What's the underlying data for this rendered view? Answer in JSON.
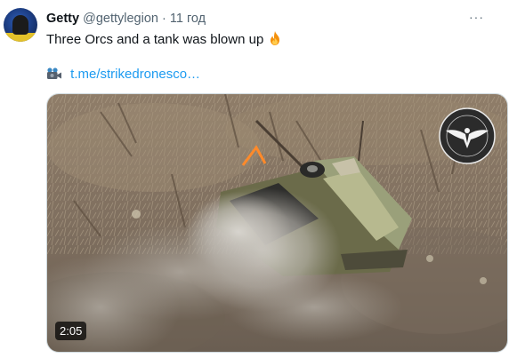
{
  "tweet": {
    "display_name": "Getty",
    "handle": "@gettylegion",
    "separator": "·",
    "time": "11 год",
    "more": "···",
    "text": "Three Orcs and a tank was blown up",
    "link_text": "t.me/strikedronesco…",
    "video_duration": "2:05"
  },
  "icons": {
    "avatar": "profile-avatar",
    "emoji": "fire-icon",
    "link_prefix": "video-camera-icon",
    "more": "more-options-icon",
    "watermark": "strike-drones-logo"
  },
  "colors": {
    "link": "#1d9bf0",
    "secondary_text": "#536471",
    "primary_text": "#0f1419"
  }
}
